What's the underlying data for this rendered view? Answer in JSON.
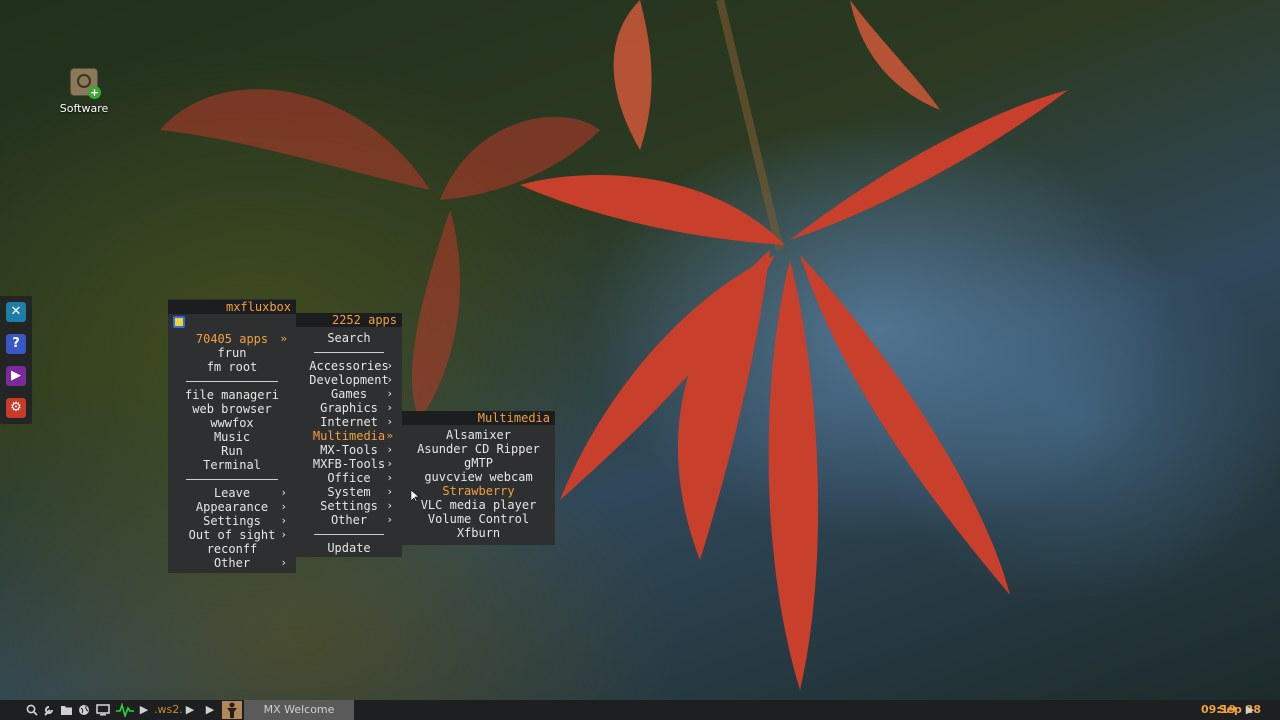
{
  "desktop": {
    "icon_label": "Software"
  },
  "main_menu": {
    "title": "mxfluxbox",
    "items": [
      {
        "label": "70405 apps",
        "arrow": "»",
        "highlight": true
      },
      {
        "label": "frun"
      },
      {
        "label": "fm root"
      },
      {
        "separator": true
      },
      {
        "label": "file manageri"
      },
      {
        "label": "web browser"
      },
      {
        "label": "wwwfox"
      },
      {
        "label": "Music"
      },
      {
        "label": "Run"
      },
      {
        "label": "Terminal"
      },
      {
        "separator": true
      },
      {
        "label": "Leave",
        "arrow": "›"
      },
      {
        "label": "Appearance",
        "arrow": "›"
      },
      {
        "label": "Settings",
        "arrow": "›"
      },
      {
        "label": "Out of sight",
        "arrow": "›"
      },
      {
        "label": "reconff"
      },
      {
        "label": "Other",
        "arrow": "›"
      }
    ]
  },
  "apps_menu": {
    "title": "2252 apps",
    "items": [
      {
        "label": "Search"
      },
      {
        "separator": true
      },
      {
        "label": "Accessories",
        "arrow": "›"
      },
      {
        "label": "Development",
        "arrow": "›"
      },
      {
        "label": "Games",
        "arrow": "›"
      },
      {
        "label": "Graphics",
        "arrow": "›"
      },
      {
        "label": "Internet",
        "arrow": "›"
      },
      {
        "label": "Multimedia",
        "arrow": "»",
        "highlight": true
      },
      {
        "label": "MX-Tools",
        "arrow": "›"
      },
      {
        "label": "MXFB-Tools",
        "arrow": "›"
      },
      {
        "label": "Office",
        "arrow": "›"
      },
      {
        "label": "System",
        "arrow": "›"
      },
      {
        "label": "Settings",
        "arrow": "›"
      },
      {
        "label": "Other",
        "arrow": "›"
      },
      {
        "separator": true
      },
      {
        "label": "Update"
      }
    ]
  },
  "multimedia_menu": {
    "title": "Multimedia",
    "items": [
      {
        "label": "Alsamixer"
      },
      {
        "label": "Asunder CD Ripper"
      },
      {
        "label": "gMTP"
      },
      {
        "label": "guvcview webcam"
      },
      {
        "label": "Strawberry",
        "highlight": true
      },
      {
        "label": "VLC media player"
      },
      {
        "label": "Volume Control"
      },
      {
        "label": "Xfburn"
      }
    ]
  },
  "taskbar": {
    "workspace_label": ".ws2.",
    "task_label": "MX Welcome",
    "clock": "09:19",
    "date": "Sep 28",
    "icons": [
      "search-icon",
      "wrench-icon",
      "folder-icon",
      "globe-icon",
      "monitor-icon",
      "activity-icon",
      "play-icon"
    ]
  },
  "dock": {
    "icons": [
      "mx-tools-icon",
      "help-icon",
      "media-player-icon",
      "settings-manager-icon"
    ]
  },
  "colors": {
    "menu_bg": "#2e2f30",
    "menu_title_bg": "#1c1d1e",
    "accent": "#f0a040",
    "taskbar_bg": "#1e1f20"
  }
}
